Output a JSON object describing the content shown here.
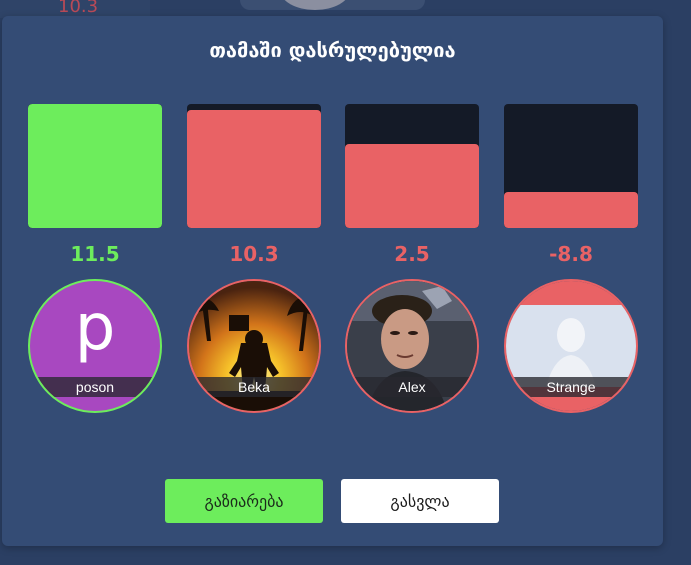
{
  "background": {
    "score_peek": "10.3"
  },
  "modal": {
    "title": "თამაში დასრულებულია"
  },
  "colors": {
    "positive": "#6ded5c",
    "negative": "#e96265",
    "bar_track": "#141a27",
    "modal_bg": "#344c75",
    "page_bg": "#2b3f63"
  },
  "players": [
    {
      "name": "poson",
      "score": "11.5",
      "bar_level": 1.0,
      "status": "positive",
      "avatar": "letter",
      "avatar_letter": "p",
      "avatar_color": "#a848c0"
    },
    {
      "name": "Beka",
      "score": "10.3",
      "bar_level": 0.95,
      "status": "negative",
      "avatar": "game-character-silhouette"
    },
    {
      "name": "Alex",
      "score": "2.5",
      "bar_level": 0.68,
      "status": "negative",
      "avatar": "person-photo"
    },
    {
      "name": "Strange",
      "score": "-8.8",
      "bar_level": 0.29,
      "status": "negative",
      "avatar": "person-photo-light"
    }
  ],
  "buttons": {
    "share": "გაზიარება",
    "exit": "გასვლა"
  }
}
